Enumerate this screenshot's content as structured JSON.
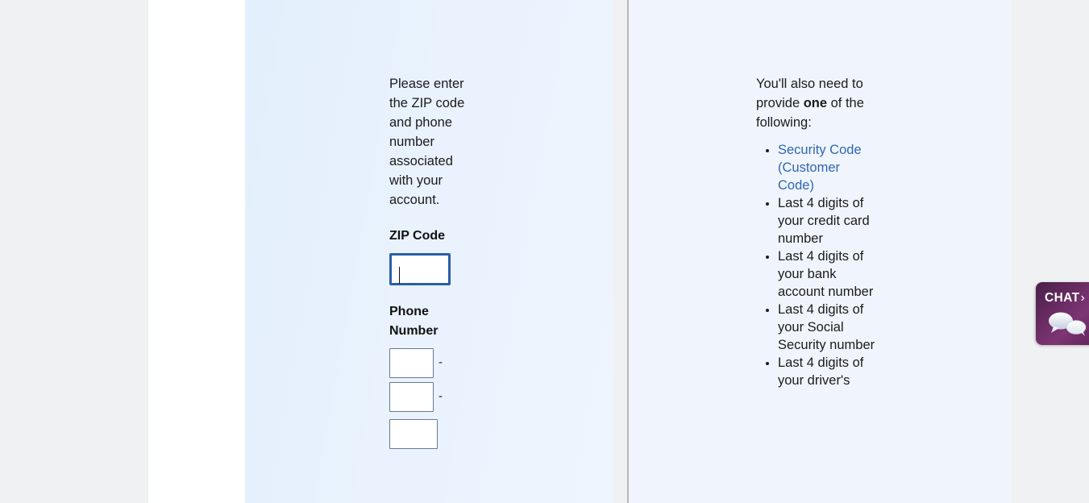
{
  "left_panel": {
    "intro_text": "Please enter the ZIP code and phone number associated with your account.",
    "zip": {
      "label": "ZIP Code",
      "value": "",
      "placeholder": ""
    },
    "phone": {
      "label": "Phone Number",
      "part1": {
        "value": "",
        "placeholder": ""
      },
      "part2": {
        "value": "",
        "placeholder": ""
      },
      "part3": {
        "value": "",
        "placeholder": ""
      },
      "separator": "-"
    }
  },
  "right_panel": {
    "intro_prefix": "You'll also need to provide ",
    "intro_emphasis": "one",
    "intro_suffix": " of the following:",
    "items": [
      {
        "text": "Security Code (Customer Code)",
        "is_link": true
      },
      {
        "text": "Last 4 digits of your credit card number",
        "is_link": false
      },
      {
        "text": "Last 4 digits of your bank account number",
        "is_link": false
      },
      {
        "text": "Last 4 digits of your Social Security number",
        "is_link": false
      },
      {
        "text": "Last 4 digits of your driver's",
        "is_link": false
      }
    ]
  },
  "chat_widget": {
    "label": "CHAT",
    "chevron": "›",
    "icon": "chat-bubbles-icon"
  },
  "colors": {
    "page_background": "#eff1f2",
    "panel_left_background": "#e6f0fc",
    "panel_right_background": "#f0f5fd",
    "link": "#3066b0",
    "input_focus_border": "#2a5fa8",
    "input_border": "#667a8f",
    "chat_purple_dark": "#4a1f4a",
    "chat_purple_light": "#7d3573",
    "text": "#1b1b1b"
  }
}
